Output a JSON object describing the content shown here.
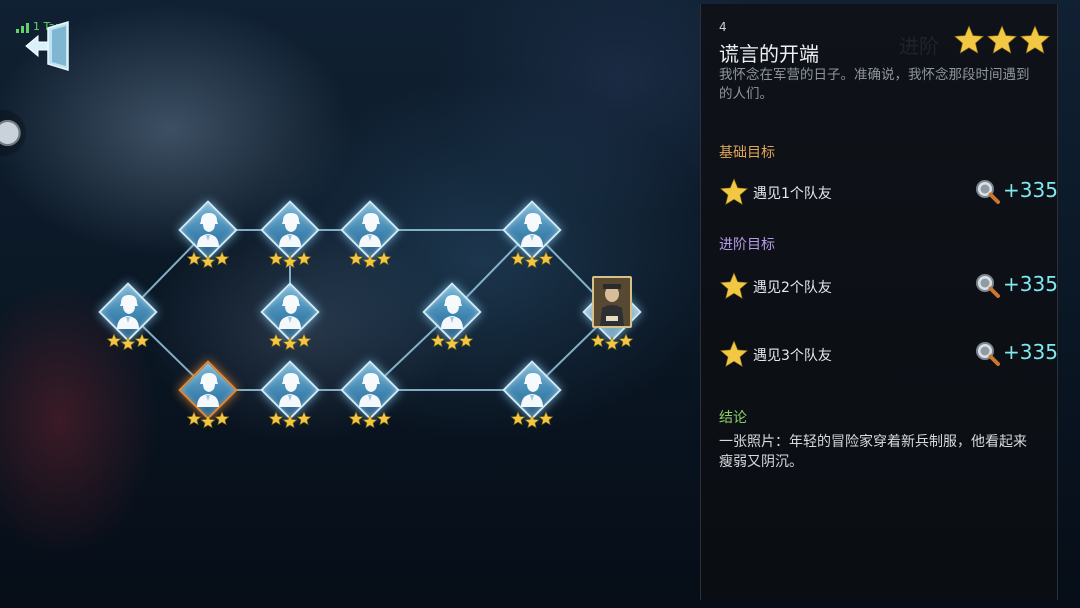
{
  "status": {
    "signal_text": "1 Taps"
  },
  "map": {
    "nodes": [
      {
        "id": "n1",
        "kind": "hint",
        "stars": 3
      },
      {
        "id": "n2",
        "kind": "hint",
        "stars": 3
      },
      {
        "id": "n3",
        "kind": "hint",
        "stars": 3
      },
      {
        "id": "n4",
        "kind": "hint",
        "stars": 3
      },
      {
        "id": "n5",
        "kind": "hint",
        "stars": 3,
        "selected": true
      },
      {
        "id": "n6",
        "kind": "hint",
        "stars": 3
      },
      {
        "id": "n7",
        "kind": "hint",
        "stars": 3
      },
      {
        "id": "n8",
        "kind": "hint",
        "stars": 3
      },
      {
        "id": "n9",
        "kind": "hint",
        "stars": 3
      },
      {
        "id": "n10",
        "kind": "hint",
        "stars": 3
      },
      {
        "id": "n11",
        "kind": "hint",
        "stars": 3
      },
      {
        "id": "n12",
        "kind": "portrait",
        "stars": 3
      }
    ],
    "colors": {
      "link": "#9fd2ea",
      "star": "#f2c744",
      "node_border": "#cfeaf7",
      "selected_border": "#e08a3a"
    }
  },
  "panel": {
    "chapter_number": "4",
    "chapter_title": "谎言的开端",
    "chapter_ghost": "进阶",
    "rating_stars": 3,
    "description": "我怀念在军营的日子。准确说，我怀念那段时间遇到的人们。",
    "basic_goal_label": "基础目标",
    "advanced_goal_label": "进阶目标",
    "conclusion_label": "结论",
    "goals": [
      {
        "text": "遇见1个队友",
        "reward": "+335"
      },
      {
        "text": "遇见2个队友",
        "reward": "+335"
      },
      {
        "text": "遇见3个队友",
        "reward": "+335"
      }
    ],
    "conclusion": "一张照片：年轻的冒险家穿着新兵制服，他看起来瘦弱又阴沉。",
    "colors": {
      "basic": "#e0a55a",
      "advanced": "#b79ae6",
      "conclusion": "#8bd06a",
      "reward": "#7fe9f1"
    }
  }
}
